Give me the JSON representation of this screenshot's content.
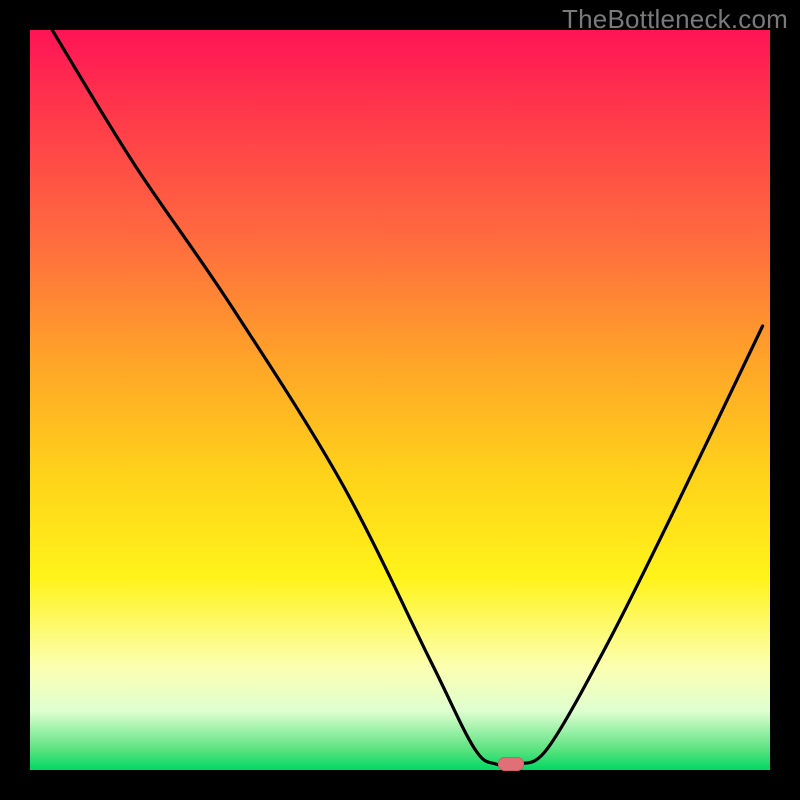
{
  "watermark": "TheBottleneck.com",
  "chart_data": {
    "type": "line",
    "title": "",
    "xlabel": "",
    "ylabel": "",
    "xlim": [
      0,
      100
    ],
    "ylim": [
      0,
      100
    ],
    "grid": false,
    "series": [
      {
        "name": "bottleneck-curve",
        "x": [
          3,
          14,
          27,
          42,
          54,
          60,
          63,
          66,
          70,
          78,
          87,
          99
        ],
        "values": [
          100,
          82,
          63,
          39,
          15,
          3,
          0.8,
          0.8,
          3,
          17,
          35,
          60
        ]
      }
    ],
    "marker": {
      "x": 65,
      "y": 0.8
    },
    "background_gradient_stops": [
      {
        "pos": 0,
        "color": "#ff1456"
      },
      {
        "pos": 12,
        "color": "#ff3b4a"
      },
      {
        "pos": 28,
        "color": "#ff6a3f"
      },
      {
        "pos": 45,
        "color": "#ffa528"
      },
      {
        "pos": 60,
        "color": "#ffd21a"
      },
      {
        "pos": 74,
        "color": "#fff31a"
      },
      {
        "pos": 86,
        "color": "#fcffb0"
      },
      {
        "pos": 92,
        "color": "#dfffd0"
      },
      {
        "pos": 97.4,
        "color": "#57e27e"
      },
      {
        "pos": 100,
        "color": "#00d864"
      }
    ]
  }
}
